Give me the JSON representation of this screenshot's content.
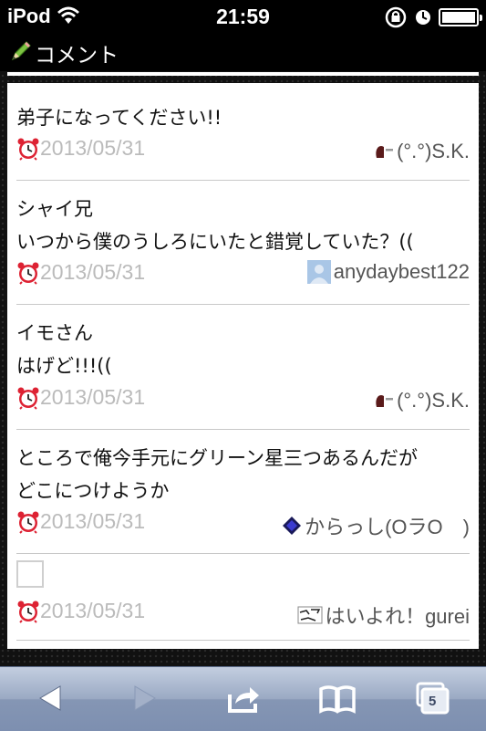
{
  "status_bar": {
    "carrier": "iPod",
    "time": "21:59"
  },
  "header": {
    "title": "コメント"
  },
  "comments": [
    {
      "lines": [
        "弟子になってください!!"
      ],
      "date": "2013/05/31",
      "user": "(°.°)S.K."
    },
    {
      "lines": [
        "シャイ兄",
        "いつから僕のうしろにいたと錯覚していた？(("
      ],
      "date": "2013/05/31",
      "user": "anydaybest122"
    },
    {
      "lines": [
        "イモさん",
        "はげど!!!(("
      ],
      "date": "2013/05/31",
      "user": "(°.°)S.K."
    },
    {
      "lines": [
        "ところで俺今手元にグリーン星三つあるんだが",
        "どこにつけようか"
      ],
      "date": "2013/05/31",
      "user": "からっし(OラO　)"
    },
    {
      "lines": [],
      "date": "2013/05/31",
      "user": "はいよれ！gurei"
    }
  ],
  "toolbar": {
    "tabs_count": "5"
  },
  "colors": {
    "date_gray": "#bbbbbb",
    "toolbar_blue": "#8f9fbb"
  }
}
